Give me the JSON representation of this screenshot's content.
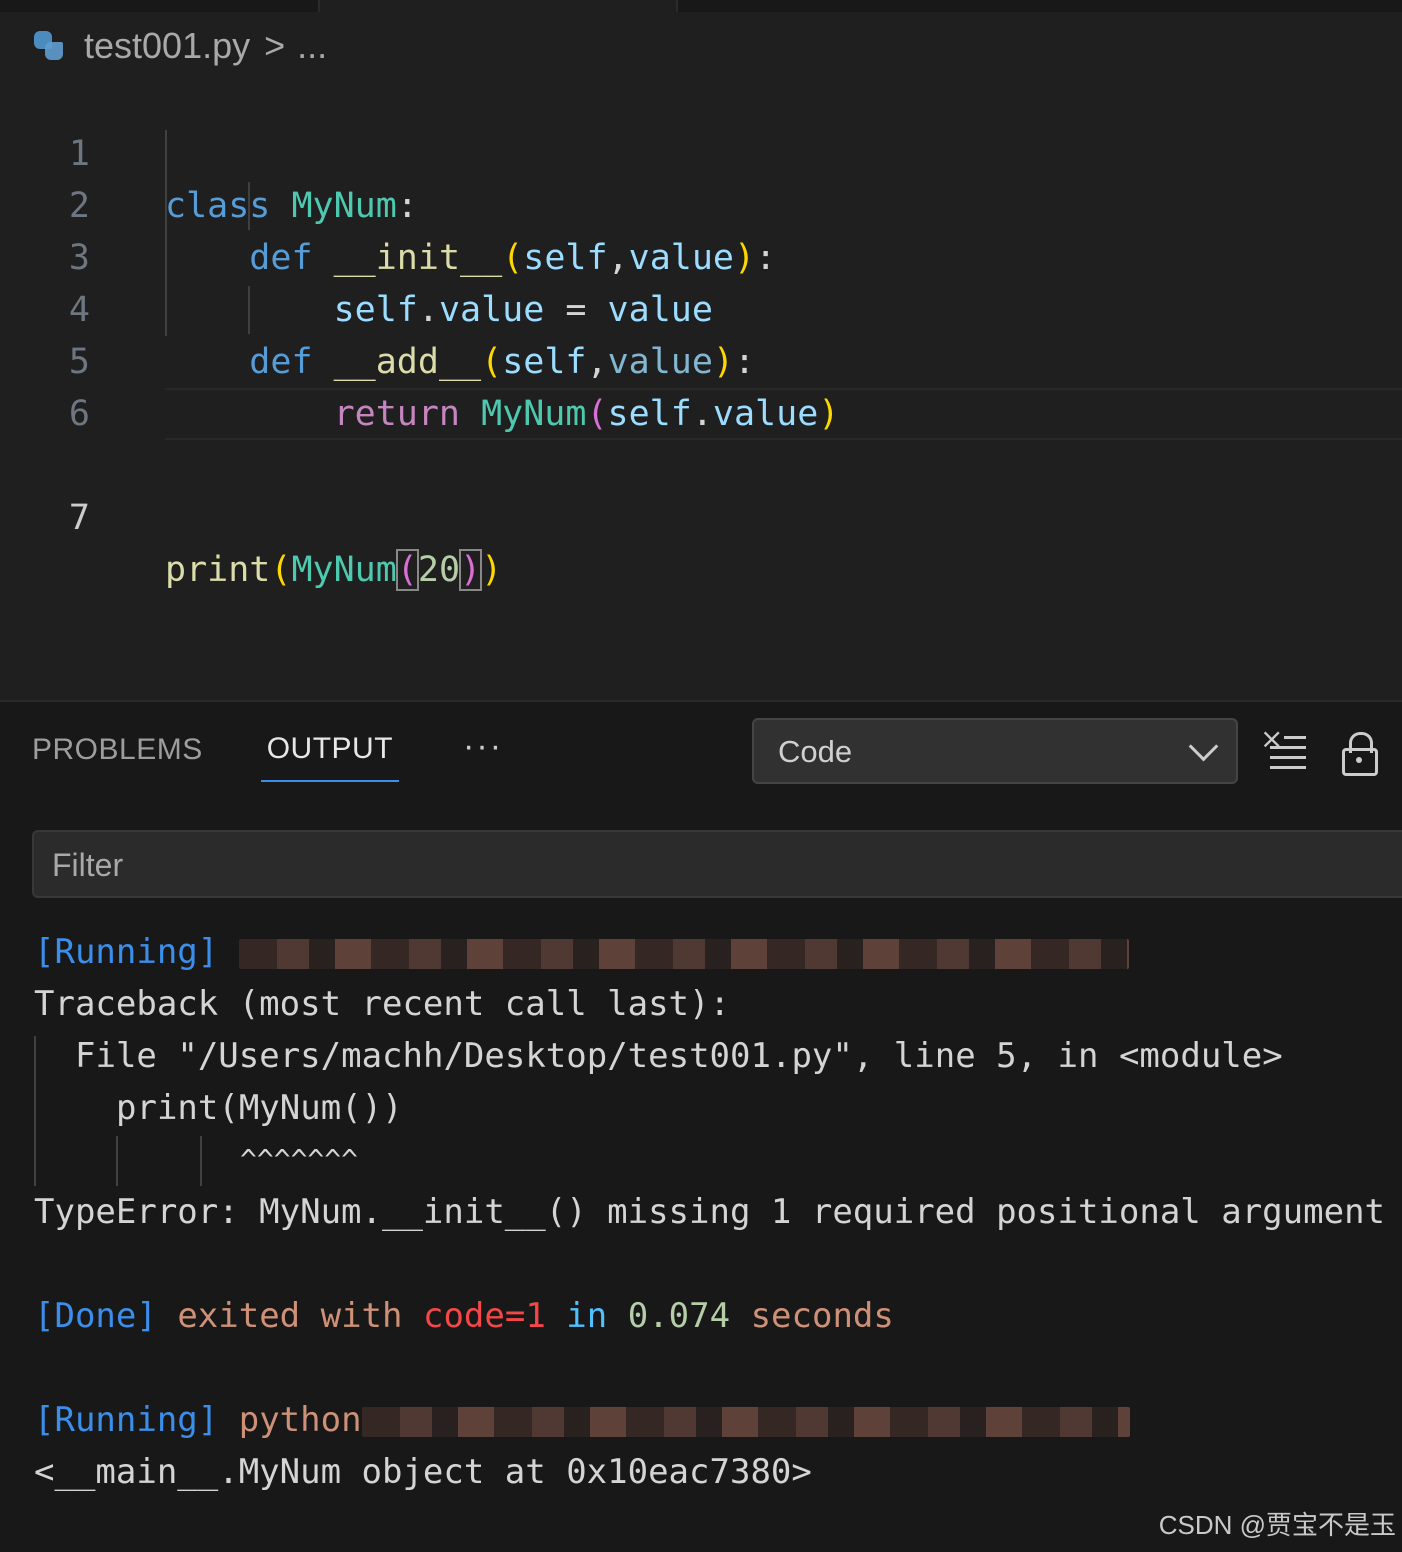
{
  "breadcrumb": {
    "file": "test001.py",
    "separator": ">",
    "more": "..."
  },
  "editor": {
    "line_numbers": [
      "1",
      "2",
      "3",
      "4",
      "5",
      "6",
      "7"
    ],
    "current_line": "7",
    "code": {
      "l1": {
        "kw": "class",
        "cls": "MyNum",
        "colon": ":"
      },
      "l2": {
        "kw": "def",
        "fn": "__init__",
        "open": "(",
        "p1": "self",
        "comma": ",",
        "p2": "value",
        "close": ")",
        "colon": ":"
      },
      "l3": {
        "self": "self",
        "dot": ".",
        "attr": "value",
        "eq": "=",
        "val": "value"
      },
      "l4": {
        "kw": "def",
        "fn": "__add__",
        "open": "(",
        "p1": "self",
        "comma": ",",
        "p2": "value",
        "close": ")",
        "colon": ":"
      },
      "l5": {
        "kw": "return",
        "cls": "MyNum",
        "open": "(",
        "self": "self",
        "dot": ".",
        "attr": "value",
        "close": ")"
      },
      "l7": {
        "fn": "print",
        "open1": "(",
        "cls": "MyNum",
        "open2": "(",
        "num": "20",
        "close2": ")",
        "close1": ")"
      }
    }
  },
  "panel": {
    "tabs": [
      {
        "label": "PROBLEMS"
      },
      {
        "label": "OUTPUT"
      }
    ],
    "more": "···",
    "channel": "Code",
    "filter_placeholder": "Filter"
  },
  "output": {
    "running1": "[Running]",
    "tb_header": "Traceback (most recent call last):",
    "file_line": "File \"/Users/machh/Desktop/test001.py\", line 5, in <module>",
    "code_line": "print(MyNum())",
    "carets": "^^^^^^^",
    "error": "TypeError: MyNum.__init__() missing 1 required positional argument",
    "done": "[Done]",
    "exited": "exited with",
    "code": "code=1",
    "in": "in",
    "time": "0.074",
    "seconds": "seconds",
    "running2": "[Running]",
    "python": "python",
    "result": "<__main__.MyNum object at 0x10eac7380>"
  },
  "watermark": "CSDN @贾宝不是玉",
  "colors": {
    "background": "#1f1f1f",
    "keyword": "#569cd6",
    "class": "#4ec9b0",
    "function": "#dcdcaa",
    "variable": "#9cdcfe",
    "bracket_gold": "#ffd700",
    "bracket_pink": "#da70d6",
    "output_blue": "#3b8eea",
    "output_red": "#f44747",
    "output_orange": "#ce9178",
    "active_tab_underline": "#3b8eea"
  }
}
